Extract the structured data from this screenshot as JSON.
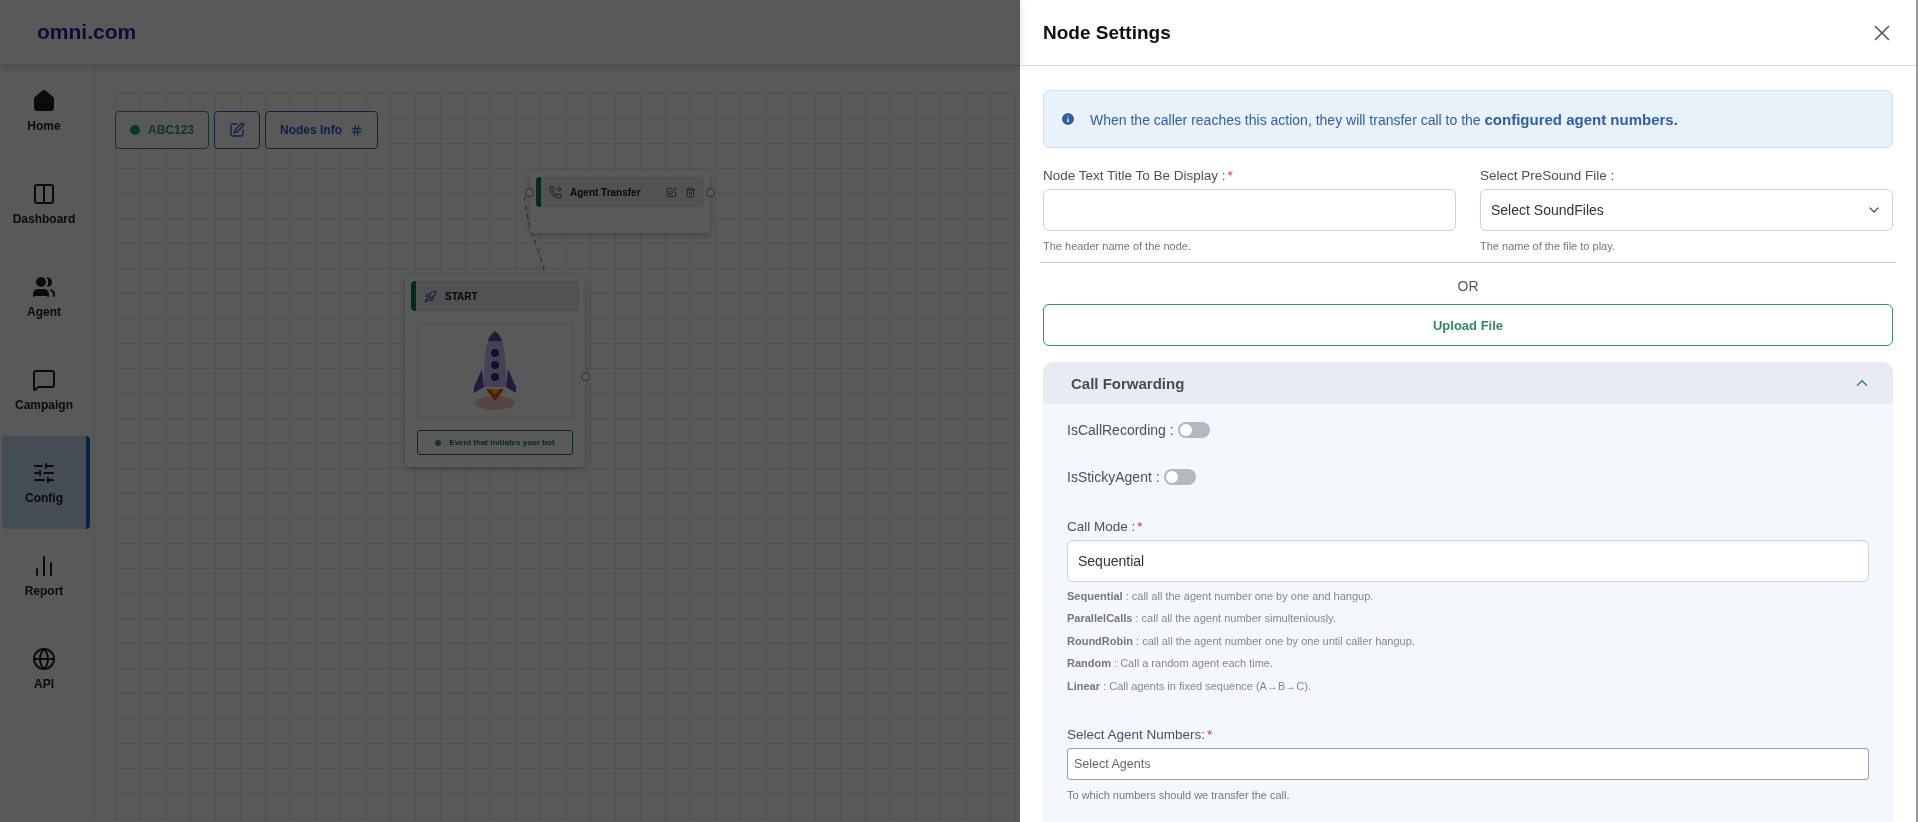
{
  "app": {
    "logo": "omni.com"
  },
  "sidebar": {
    "items": [
      {
        "kind": "home",
        "label": "Home",
        "selected": false
      },
      {
        "kind": "dashboard",
        "label": "Dashboard",
        "selected": false
      },
      {
        "kind": "agent",
        "label": "Agent",
        "selected": false
      },
      {
        "kind": "campaign",
        "label": "Campaign",
        "selected": false
      },
      {
        "kind": "config",
        "label": "Config",
        "selected": true
      },
      {
        "kind": "report",
        "label": "Report",
        "selected": false
      },
      {
        "kind": "api",
        "label": "API",
        "selected": false
      }
    ]
  },
  "toolbar": {
    "flow_name": "ABC123",
    "nodes_info": "Nodes Info"
  },
  "nodes": [
    {
      "kind": "agent_transfer",
      "title": "Agent Transfer"
    },
    {
      "kind": "start",
      "title": "START",
      "event": "Event that initiates your bot"
    }
  ],
  "panel": {
    "title": "Node Settings",
    "info": "When the caller reaches this action, they will transfer call to the **configured agent numbers.**",
    "fields": [
      {
        "kind": "text",
        "label": "Node Text Title To Be Display :",
        "required_mark": "*",
        "hint": "The header name of the node."
      },
      {
        "kind": "select",
        "label": "Select PreSound File :",
        "value": "Select SoundFiles",
        "hint": "The name of the file to play."
      }
    ],
    "or": "OR",
    "upload": "Upload File",
    "section": {
      "title": "Call Forwarding",
      "expanded": true,
      "toggles": [
        {
          "label": "IsCallRecording :",
          "on": false
        },
        {
          "label": "IsStickyAgent :",
          "on": false
        }
      ],
      "call_mode": {
        "label": "Call Mode :",
        "required_mark": "*",
        "value": "Sequential",
        "help": [
          "**Sequential** : call all the agent number one by one and hangup.",
          "**ParallelCalls** : call all the agent number simulteniously.",
          "**RoundRobin** : call all the agent number one by one until caller hangup.",
          "**Random** : Call a random agent each time.",
          "**Linear** : Call agents in fixed sequence (A→B→C)."
        ]
      },
      "agents": {
        "label": "Select Agent Numbers:",
        "required_mark": "*",
        "placeholder": "Select Agents",
        "hint": "To which numbers should we transfer the call."
      }
    }
  }
}
